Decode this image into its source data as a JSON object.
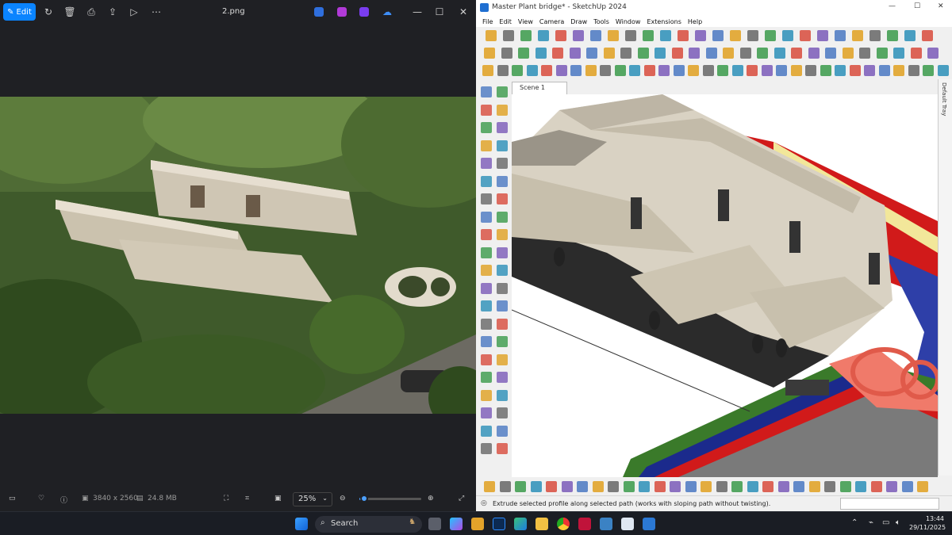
{
  "photos": {
    "edit_label": "Edit",
    "title": "2.png",
    "dimensions": "3840 x 2560",
    "file_size": "24.8 MB",
    "zoom": "25%",
    "zoom_level": 0.08
  },
  "sketchup": {
    "title": "Master Plant bridge* - SketchUp 2024",
    "menu": [
      "File",
      "Edit",
      "View",
      "Camera",
      "Draw",
      "Tools",
      "Window",
      "Extensions",
      "Help"
    ],
    "scene_tab": "Scene 1",
    "tray_label": "Default Tray",
    "status_text": "Extrude selected profile along selected path (works with sloping path without twisting)."
  },
  "taskbar": {
    "search_placeholder": "Search",
    "time": "13:44",
    "date": "29/11/2025"
  },
  "colors": {
    "accent": "#0a84ff",
    "photos_bg": "#1f2024",
    "taskbar_bg": "#1a1d24"
  }
}
